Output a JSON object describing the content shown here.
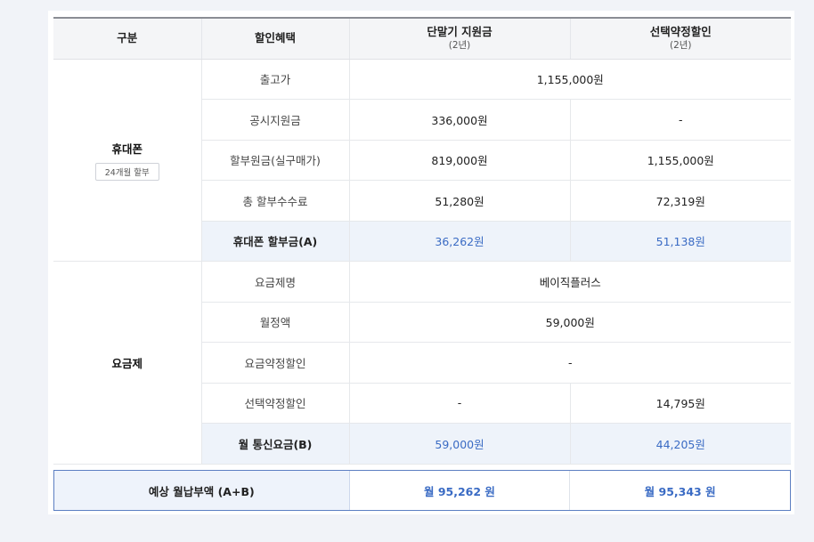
{
  "header": {
    "col_category": "구분",
    "col_benefit": "할인혜택",
    "col_device_support": "단말기 지원금",
    "col_device_support_sub": "(2년)",
    "col_selective_discount": "선택약정할인",
    "col_selective_discount_sub": "(2년)"
  },
  "phone": {
    "group_label": "휴대폰",
    "badge": "24개월 할부",
    "rows": [
      {
        "label": "출고가",
        "merged": "1,155,000원"
      },
      {
        "label": "공시지원금",
        "support": "336,000원",
        "selective": "-"
      },
      {
        "label": "할부원금(실구매가)",
        "support": "819,000원",
        "selective": "1,155,000원"
      },
      {
        "label": "총 할부수수료",
        "support": "51,280원",
        "selective": "72,319원"
      },
      {
        "label": "휴대폰 할부금(A)",
        "support": "36,262원",
        "selective": "51,138원"
      }
    ]
  },
  "plan": {
    "group_label": "요금제",
    "rows": [
      {
        "label": "요금제명",
        "merged": "베이직플러스"
      },
      {
        "label": "월정액",
        "merged": "59,000원"
      },
      {
        "label": "요금약정할인",
        "merged": "-"
      },
      {
        "label": "선택약정할인",
        "support": "-",
        "selective": "14,795원"
      },
      {
        "label": "월 통신요금(B)",
        "support": "59,000원",
        "selective": "44,205원"
      }
    ]
  },
  "total": {
    "label": "예상 월납부액 (A+B)",
    "support": "월 95,262 원",
    "selective": "월 95,343 원"
  }
}
